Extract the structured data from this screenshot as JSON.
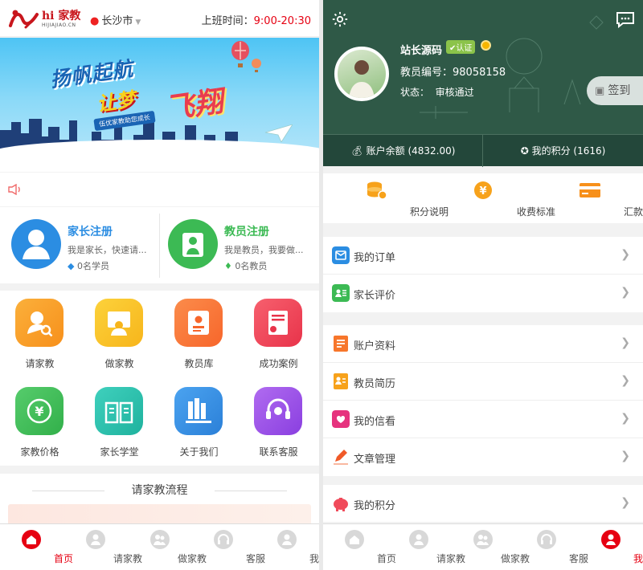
{
  "left": {
    "header": {
      "brand": "hi 家教",
      "brand_sub": "HIJIAJIAO.CN",
      "city": "长沙市",
      "hours_label": "上班时间：",
      "hours_value": "9:00-20:30"
    },
    "banner": {
      "headline1": "扬帆起航",
      "headline2": "让梦",
      "headline3": "飞翔",
      "tagline": "伍优家教助您成长"
    },
    "register": [
      {
        "title": "家长注册",
        "desc": "我是家长，快速请...",
        "count": "0名学员",
        "color": "#2b8de2"
      },
      {
        "title": "教员注册",
        "desc": "我是教员，我要做...",
        "count": "0名教员",
        "color": "#3cba54"
      }
    ],
    "grid": [
      {
        "label": "请家教",
        "icon": "search-user-icon",
        "color": "#f7a21b"
      },
      {
        "label": "做家教",
        "icon": "teacher-board-icon",
        "color": "#f7c21b"
      },
      {
        "label": "教员库",
        "icon": "profile-card-icon",
        "color": "#f7762b"
      },
      {
        "label": "成功案例",
        "icon": "certificate-icon",
        "color": "#f04a5a"
      },
      {
        "label": "家教价格",
        "icon": "yen-icon",
        "color": "#3cba54"
      },
      {
        "label": "家长学堂",
        "icon": "open-book-icon",
        "color": "#2bbfae"
      },
      {
        "label": "关于我们",
        "icon": "books-icon",
        "color": "#2b8de2"
      },
      {
        "label": "联系客服",
        "icon": "headset-icon",
        "color": "#9b4de2"
      }
    ],
    "flow_title": "请家教流程",
    "tabs": [
      {
        "label": "首页",
        "icon": "home-icon",
        "active": true
      },
      {
        "label": "请家教",
        "icon": "person-icon",
        "active": false
      },
      {
        "label": "做家教",
        "icon": "group-icon",
        "active": false
      },
      {
        "label": "客服",
        "icon": "service-icon",
        "active": false
      },
      {
        "label": "我的",
        "icon": "user-icon",
        "active": false
      }
    ]
  },
  "right": {
    "profile": {
      "name": "站长源码",
      "verified": "认证",
      "teacher_no": "教员编号：98058158",
      "status_label": "状态：",
      "status_value": "审核通过",
      "signin": "签到"
    },
    "balance": {
      "account": "账户余额 (4832.00)",
      "points": "我的积分 (1616)"
    },
    "quick": [
      {
        "label": "积分说明",
        "icon": "coins-icon"
      },
      {
        "label": "收费标准",
        "icon": "yen-coin-icon"
      },
      {
        "label": "汇款账号",
        "icon": "bank-card-icon"
      }
    ],
    "menu_groups": [
      [
        {
          "label": "我的订单",
          "icon": "order-icon",
          "color": "#2b8de2"
        },
        {
          "label": "家长评价",
          "icon": "review-icon",
          "color": "#3cba54"
        }
      ],
      [
        {
          "label": "账户资料",
          "icon": "account-doc-icon",
          "color": "#f7762b"
        },
        {
          "label": "教员简历",
          "icon": "resume-icon",
          "color": "#f7a21b"
        },
        {
          "label": "我的信看",
          "icon": "mail-heart-icon",
          "color": "#e6337e"
        },
        {
          "label": "文章管理",
          "icon": "pencil-icon",
          "color": "#f05a28"
        }
      ],
      [
        {
          "label": "我的积分",
          "icon": "piggy-bank-icon",
          "color": "#f04a5a"
        }
      ]
    ],
    "tabs": [
      {
        "label": "首页",
        "icon": "home-icon",
        "active": false
      },
      {
        "label": "请家教",
        "icon": "person-icon",
        "active": false
      },
      {
        "label": "做家教",
        "icon": "group-icon",
        "active": false
      },
      {
        "label": "客服",
        "icon": "service-icon",
        "active": false
      },
      {
        "label": "我的",
        "icon": "user-icon",
        "active": true
      }
    ]
  }
}
